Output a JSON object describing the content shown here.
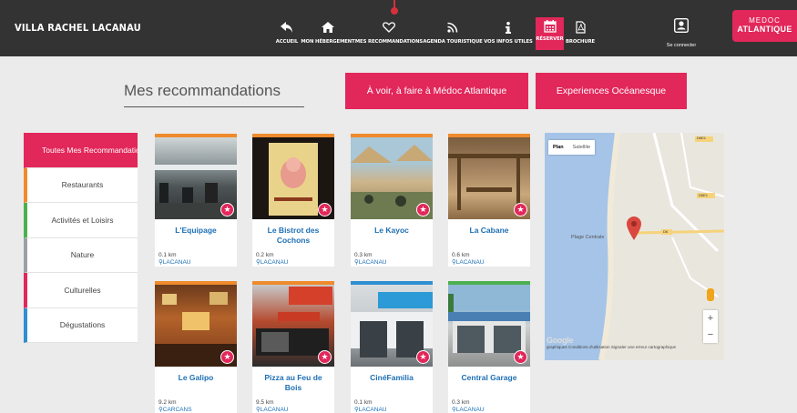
{
  "site": {
    "brand": "VILLA RACHEL LACANAU"
  },
  "nav": [
    {
      "label": "ACCUEIL",
      "icon": "back-arrow-icon"
    },
    {
      "label": "MON HÉBERGEMENT",
      "icon": "home-icon"
    },
    {
      "label": "MES RECOMMANDATIONS",
      "icon": "heart-icon"
    },
    {
      "label": "AGENDA TOURISTIQUE",
      "icon": "rss-icon"
    },
    {
      "label": "VOS INFOS UTILES",
      "icon": "info-icon"
    },
    {
      "label": "RÉSERVER",
      "icon": "calendar-icon"
    },
    {
      "label": "BROCHURE",
      "icon": "pdf-icon"
    }
  ],
  "login": {
    "label": "Se connecter",
    "icon": "user-icon"
  },
  "logo": {
    "line1": "MEDOC",
    "line2": "ATLANTIQUE"
  },
  "page": {
    "title": "Mes recommandations",
    "button_a": "À voir, à faire à Médoc Atlantique",
    "button_b": "Experiences Océanesque"
  },
  "sidebar": [
    {
      "label": "Toutes Mes Recommandations",
      "color": "#e2275a"
    },
    {
      "label": "Restaurants",
      "color": "#ef8b2c"
    },
    {
      "label": "Activités et Loisirs",
      "color": "#4bb04f"
    },
    {
      "label": "Nature",
      "color": "#9aa0a6"
    },
    {
      "label": "Culturelles",
      "color": "#e2275a"
    },
    {
      "label": "Dégustations",
      "color": "#2f8fd1"
    }
  ],
  "cards": [
    {
      "name": "L'Equipage",
      "distance": "0.1 km",
      "city": "LACANAU",
      "color": "#ef8b2c"
    },
    {
      "name": "Le Bistrot des Cochons",
      "distance": "0.2 km",
      "city": "LACANAU",
      "color": "#ef8b2c"
    },
    {
      "name": "Le Kayoc",
      "distance": "0.3 km",
      "city": "LACANAU",
      "color": "#ef8b2c"
    },
    {
      "name": "La Cabane",
      "distance": "0.6 km",
      "city": "LACANAU",
      "color": "#ef8b2c"
    },
    {
      "name": "Le Galipo",
      "distance": "9.2 km",
      "city": "CARCANS",
      "color": "#ef8b2c"
    },
    {
      "name": "Pizza au Feu de Bois",
      "distance": "9.5 km",
      "city": "LACANAU",
      "color": "#ef8b2c"
    },
    {
      "name": "CinéFamilia",
      "distance": "0.1 km",
      "city": "LACANAU",
      "color": "#2f8fd1"
    },
    {
      "name": "Central Garage",
      "distance": "0.3 km",
      "city": "LACANAU",
      "color": "#4bb04f"
    }
  ],
  "map": {
    "tab_plan": "Plan",
    "tab_satellite": "Satellite",
    "place": "Plage Centrale",
    "road1": "D6E1",
    "road2": "D6",
    "road3": "D6E1",
    "google": "Google",
    "footer": "graphiques  Conditions d'utilisation   Signaler une erreur cartographique",
    "zoom_in": "+",
    "zoom_out": "−"
  }
}
